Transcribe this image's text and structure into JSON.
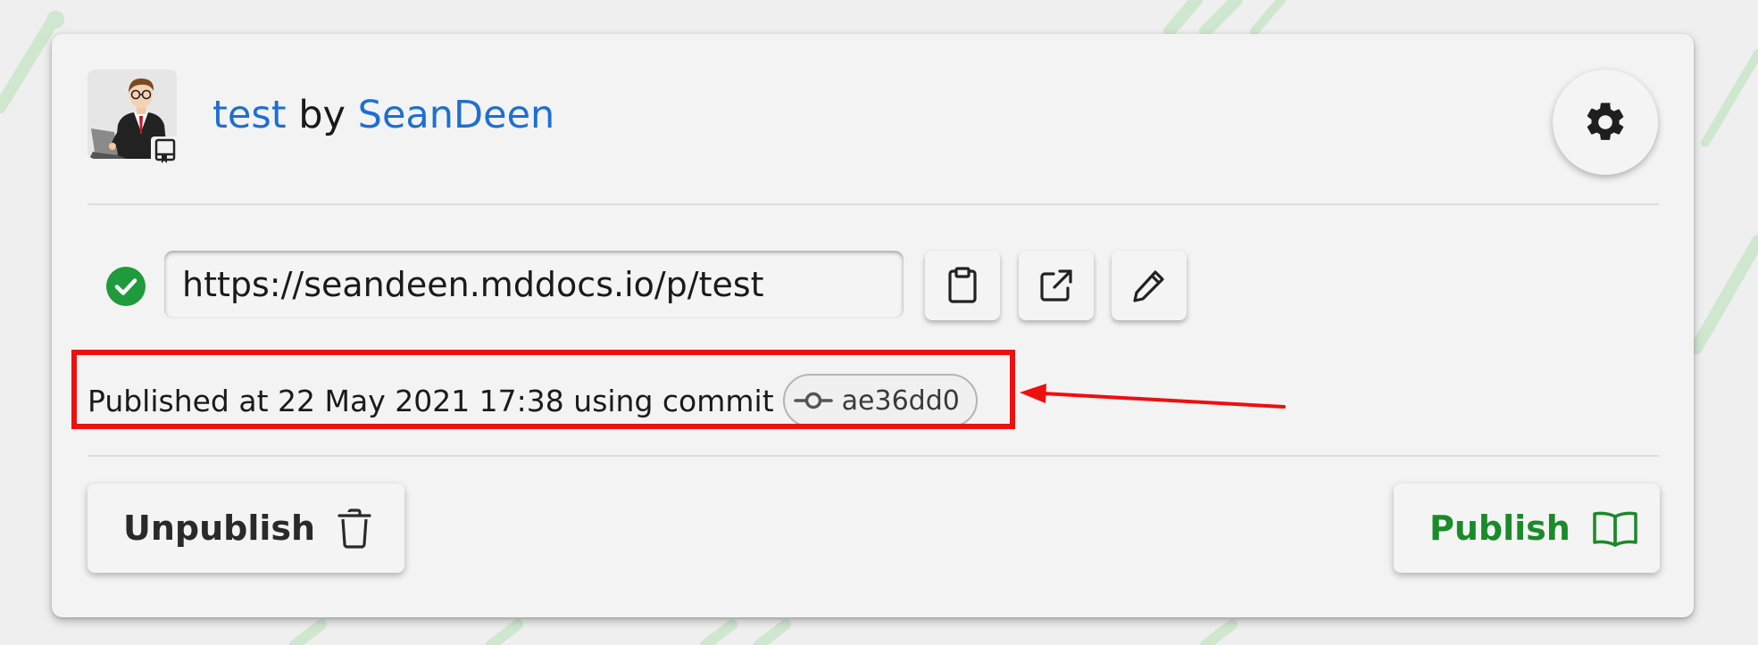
{
  "header": {
    "project_name": "test",
    "by_text": " by ",
    "author": "SeanDeen"
  },
  "url_field": {
    "value": "https://seandeen.mddocs.io/p/test"
  },
  "status": {
    "published_text": "Published at 22 May 2021 17:38 using commit",
    "commit_hash": "ae36dd0"
  },
  "actions": {
    "unpublish_label": "Unpublish",
    "publish_label": "Publish"
  },
  "icons": {
    "settings": "gear-icon",
    "status": "check-circle-icon",
    "copy": "clipboard-icon",
    "open": "external-link-icon",
    "edit": "pencil-icon",
    "commit": "git-commit-icon",
    "unpublish": "trash-icon",
    "publish": "book-open-icon",
    "badge": "bookmark-book-icon"
  },
  "colors": {
    "link": "#1e6fd0",
    "success": "#1a8a2a",
    "annotation": "#ee0f0f",
    "background_stripes": "#cfe6cf"
  }
}
